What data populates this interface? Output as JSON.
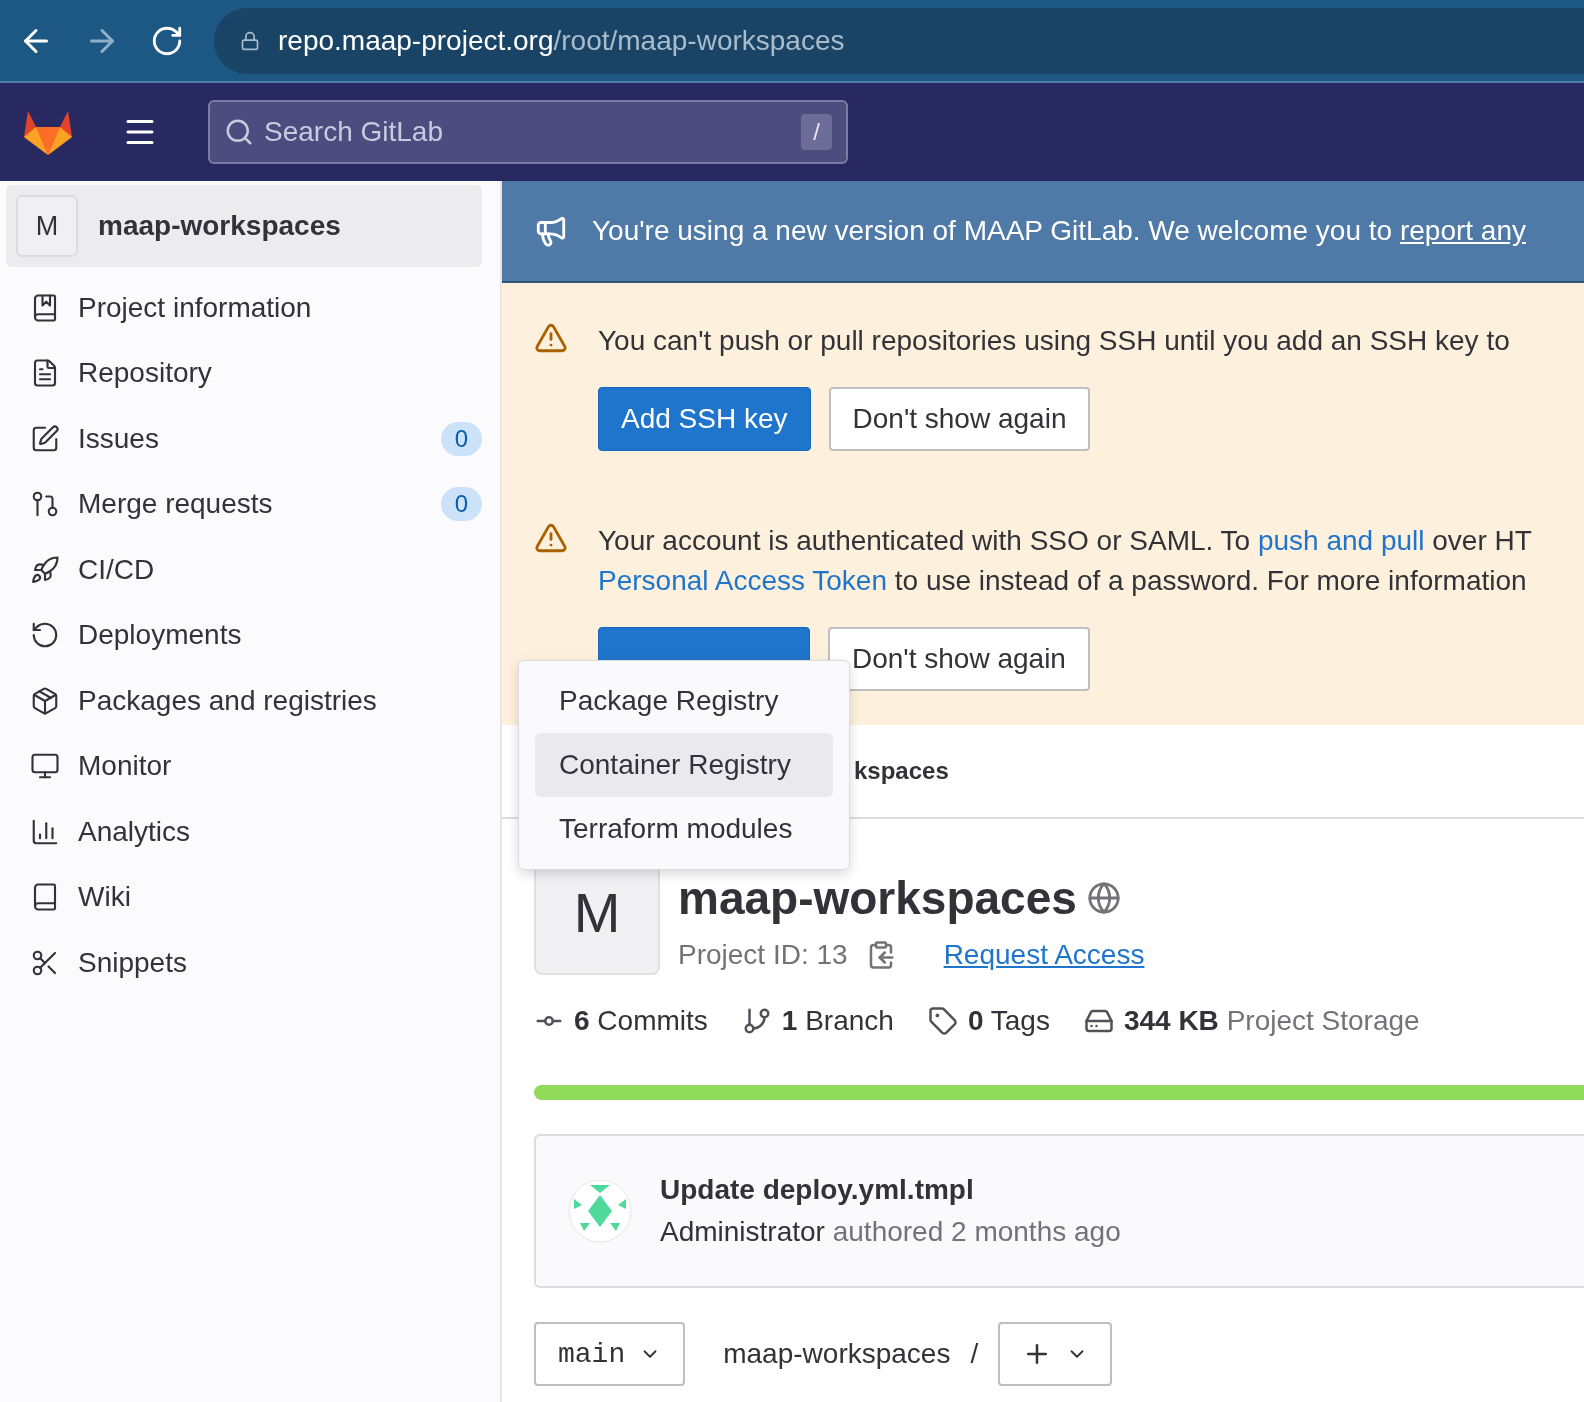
{
  "browser": {
    "url_host": "repo.maap-project.org",
    "url_path": "/root/maap-workspaces"
  },
  "header": {
    "search_placeholder": "Search GitLab",
    "shortcut": "/"
  },
  "sidebar": {
    "project": {
      "avatar": "M",
      "name": "maap-workspaces"
    },
    "items": [
      {
        "label": "Project information"
      },
      {
        "label": "Repository"
      },
      {
        "label": "Issues",
        "count": "0"
      },
      {
        "label": "Merge requests",
        "count": "0"
      },
      {
        "label": "CI/CD"
      },
      {
        "label": "Deployments"
      },
      {
        "label": "Packages and registries"
      },
      {
        "label": "Monitor"
      },
      {
        "label": "Analytics"
      },
      {
        "label": "Wiki"
      },
      {
        "label": "Snippets"
      }
    ]
  },
  "banner": {
    "segments": [
      {
        "text": "You're using a new version of MAAP GitLab. We welcome you to ",
        "link": false
      },
      {
        "text": "report any",
        "link": true
      }
    ]
  },
  "alerts": [
    {
      "lines": [
        [
          {
            "text": "You can't push or pull repositories using SSH until you add an SSH key to",
            "link": false
          }
        ]
      ],
      "buttons": [
        {
          "label": "Add SSH key",
          "kind": "primary"
        },
        {
          "label": "Don't show again",
          "kind": "secondary"
        }
      ]
    },
    {
      "lines": [
        [
          {
            "text": "Your account is authenticated with SSO or SAML. To ",
            "link": false
          },
          {
            "text": "push and pull",
            "link": true
          },
          {
            "text": " over HT",
            "link": false
          }
        ],
        [
          {
            "text": "Personal Access Token",
            "link": true
          },
          {
            "text": " to use instead of a password. For more information",
            "link": false
          }
        ]
      ],
      "buttons": [
        {
          "kind": "primary"
        },
        {
          "label": "Don't show again",
          "kind": "secondary"
        }
      ]
    }
  ],
  "dropdown": {
    "items": [
      {
        "label": "Package Registry",
        "selected": false
      },
      {
        "label": "Container Registry",
        "selected": true
      },
      {
        "label": "Terraform modules",
        "selected": false
      }
    ]
  },
  "breadcrumb": "kspaces",
  "project": {
    "avatar": "M",
    "name": "maap-workspaces",
    "id_label": "Project ID: 13",
    "request_access": "Request Access"
  },
  "stats": [
    {
      "value": "6",
      "label": "Commits"
    },
    {
      "value": "1",
      "label": "Branch"
    },
    {
      "value": "0",
      "label": "Tags"
    },
    {
      "value": "344 KB",
      "label": "Project Storage"
    }
  ],
  "commit": {
    "title": "Update deploy.yml.tmpl",
    "author": "Administrator",
    "meta": "authored 2 months ago"
  },
  "tree": {
    "branch": "main",
    "path": "maap-workspaces",
    "separator": "/"
  }
}
